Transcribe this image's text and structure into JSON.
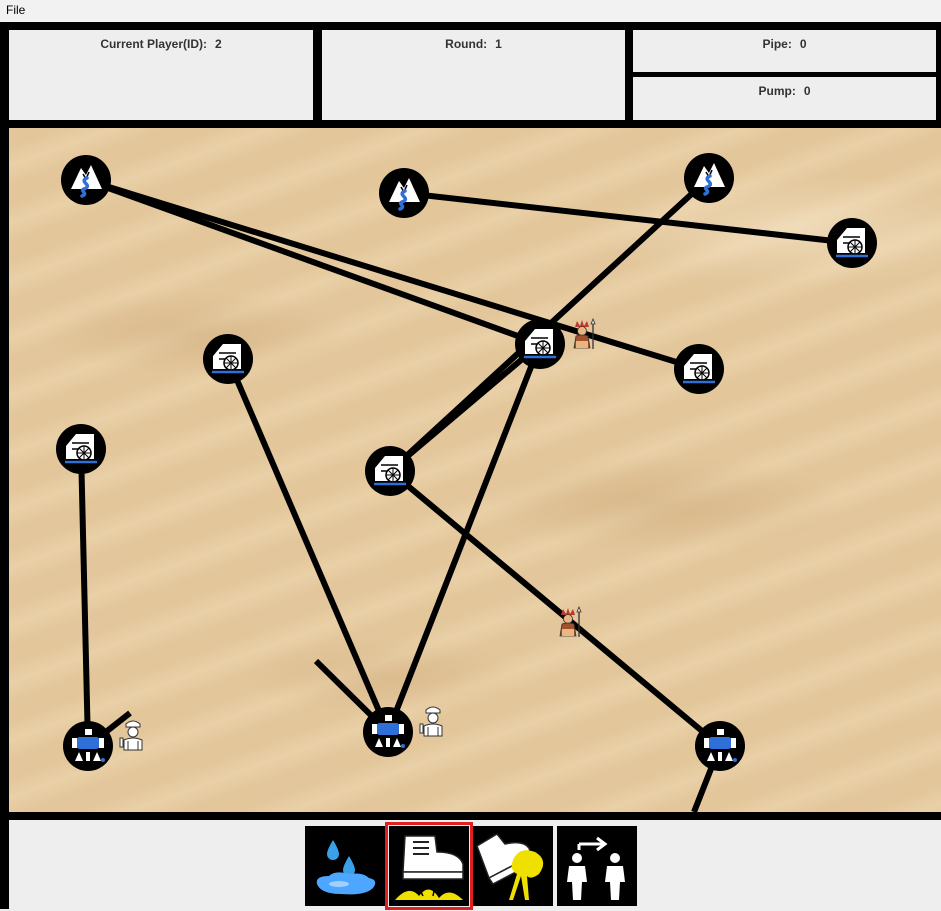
{
  "menubar": {
    "file_label": "File"
  },
  "header": {
    "current_player_label": "Current Player(ID):",
    "current_player_value": "2",
    "round_label": "Round:",
    "round_value": "1",
    "pipe_label": "Pipe:",
    "pipe_value": "0",
    "pump_label": "Pump:",
    "pump_value": "0"
  },
  "board": {
    "node_icons": {
      "spring": "spring-icon",
      "pump": "pump-icon",
      "cistern": "cistern-icon"
    },
    "player_icons": {
      "plumber": "plumber-icon",
      "saboteur": "saboteur-icon"
    }
  },
  "toolbar": {
    "actions": [
      {
        "name": "leak-action",
        "icon": "water-leak-icon"
      },
      {
        "name": "step-action",
        "icon": "step-boot-icon",
        "selected": true
      },
      {
        "name": "sticky-action",
        "icon": "sticky-boot-icon"
      },
      {
        "name": "move-action",
        "icon": "move-players-icon"
      }
    ],
    "selected_color": "#e02020"
  }
}
